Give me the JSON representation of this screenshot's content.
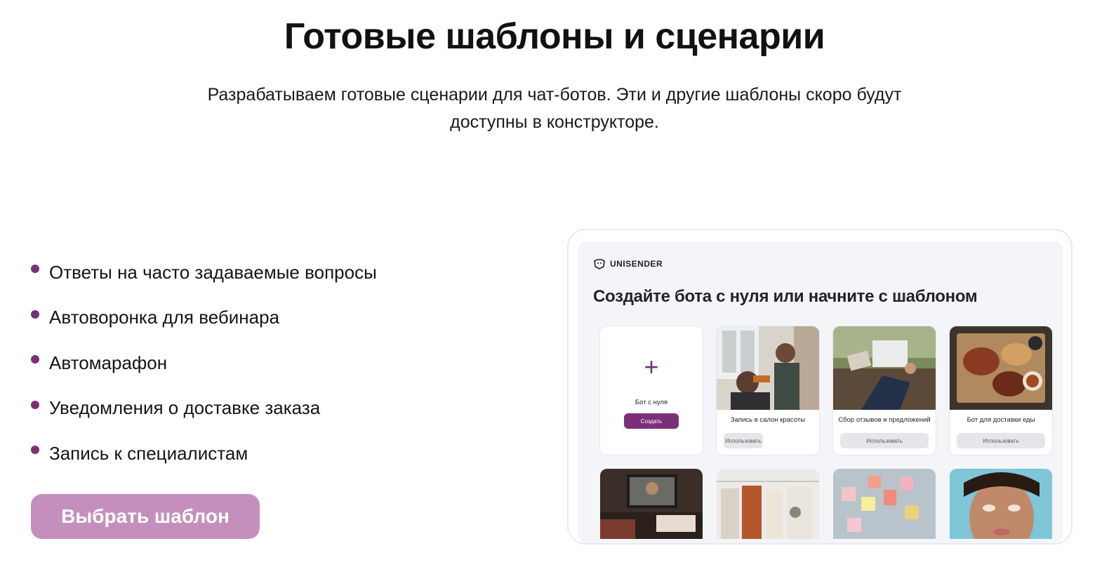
{
  "header": {
    "title": "Готовые шаблоны и сценарии",
    "subtitle_line1": "Разрабатываем готовые сценарии для чат-ботов. Эти и другие шаблоны скоро будут",
    "subtitle_line2": "доступны в конструкторе."
  },
  "features": [
    "Ответы на часто задаваемые вопросы",
    "Автоворонка для вебинара",
    "Автомарафон",
    "Уведомления о доставке заказа",
    "Запись к специалистам"
  ],
  "cta": {
    "label": "Выбрать шаблон"
  },
  "preview": {
    "logo_text": "UNISENDER",
    "title": "Создайте бота с нуля или начните с шаблоном",
    "blank_card": {
      "plus": "+",
      "label": "Бот с нуля",
      "button": "Создать"
    },
    "templates": [
      {
        "label": "Запись в салон красоты",
        "button": "Использовать"
      },
      {
        "label": "Сбор отзывов и предложений",
        "button": "Использовать"
      },
      {
        "label": "Бот для доставки еды",
        "button": "Использовать"
      }
    ]
  },
  "colors": {
    "accent": "#7c2f79",
    "cta_bg": "#c58fbd",
    "screen_bg": "#f4f5f9"
  }
}
